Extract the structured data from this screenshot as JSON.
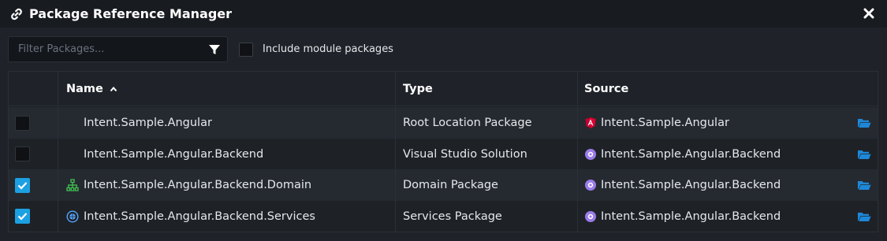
{
  "window": {
    "title": "Package Reference Manager",
    "title_icon": "link-icon",
    "close_icon": "close-icon"
  },
  "toolbar": {
    "filter_placeholder": "Filter Packages...",
    "filter_value": "",
    "filter_icon": "funnel-icon",
    "include_module_label": "Include module packages",
    "include_module_checked": false
  },
  "grid": {
    "columns": {
      "name": "Name",
      "type": "Type",
      "source": "Source"
    },
    "sort": {
      "column": "name",
      "direction": "ascending"
    },
    "rows": [
      {
        "checked": false,
        "icon": "none",
        "name": "Intent.Sample.Angular",
        "type": "Root Location Package",
        "source_icon": "angular-icon",
        "source": "Intent.Sample.Angular"
      },
      {
        "checked": false,
        "icon": "none",
        "name": "Intent.Sample.Angular.Backend",
        "type": "Visual Studio Solution",
        "source_icon": "visual-studio-icon",
        "source": "Intent.Sample.Angular.Backend"
      },
      {
        "checked": true,
        "icon": "domain-hierarchy-icon",
        "name": "Intent.Sample.Angular.Backend.Domain",
        "type": "Domain Package",
        "source_icon": "visual-studio-icon",
        "source": "Intent.Sample.Angular.Backend"
      },
      {
        "checked": true,
        "icon": "services-globe-icon",
        "name": "Intent.Sample.Angular.Backend.Services",
        "type": "Services Package",
        "source_icon": "visual-studio-icon",
        "source": "Intent.Sample.Angular.Backend"
      }
    ]
  },
  "colors": {
    "accent": "#1ba1e2",
    "folder": "#1e88d8",
    "angular": "#c3002f",
    "vs": "#9b7be8",
    "domain": "#3fb950",
    "services": "#58a6ff"
  }
}
